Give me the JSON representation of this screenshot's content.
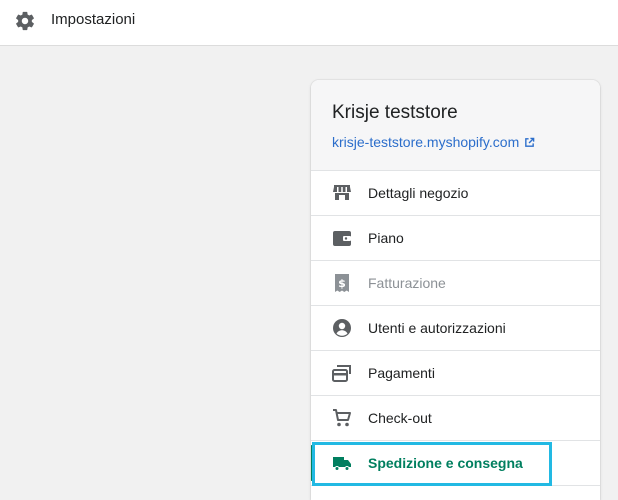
{
  "header": {
    "title": "Impostazioni",
    "icon": "gear-icon"
  },
  "store": {
    "name": "Krisje teststore",
    "url": "krisje-teststore.myshopify.com"
  },
  "menu": [
    {
      "label": "Dettagli negozio",
      "icon": "store-icon",
      "state": "normal"
    },
    {
      "label": "Piano",
      "icon": "wallet-icon",
      "state": "normal"
    },
    {
      "label": "Fatturazione",
      "icon": "billing-icon",
      "state": "disabled"
    },
    {
      "label": "Utenti e autorizzazioni",
      "icon": "user-icon",
      "state": "normal"
    },
    {
      "label": "Pagamenti",
      "icon": "payments-icon",
      "state": "normal"
    },
    {
      "label": "Check-out",
      "icon": "cart-icon",
      "state": "normal"
    },
    {
      "label": "Spedizione e consegna",
      "icon": "truck-icon",
      "state": "active"
    }
  ],
  "colors": {
    "link": "#2c6ecb",
    "active": "#007f5f",
    "highlight": "#22b9e3",
    "icon": "#5c5f62",
    "icon_disabled": "#8c9196"
  }
}
